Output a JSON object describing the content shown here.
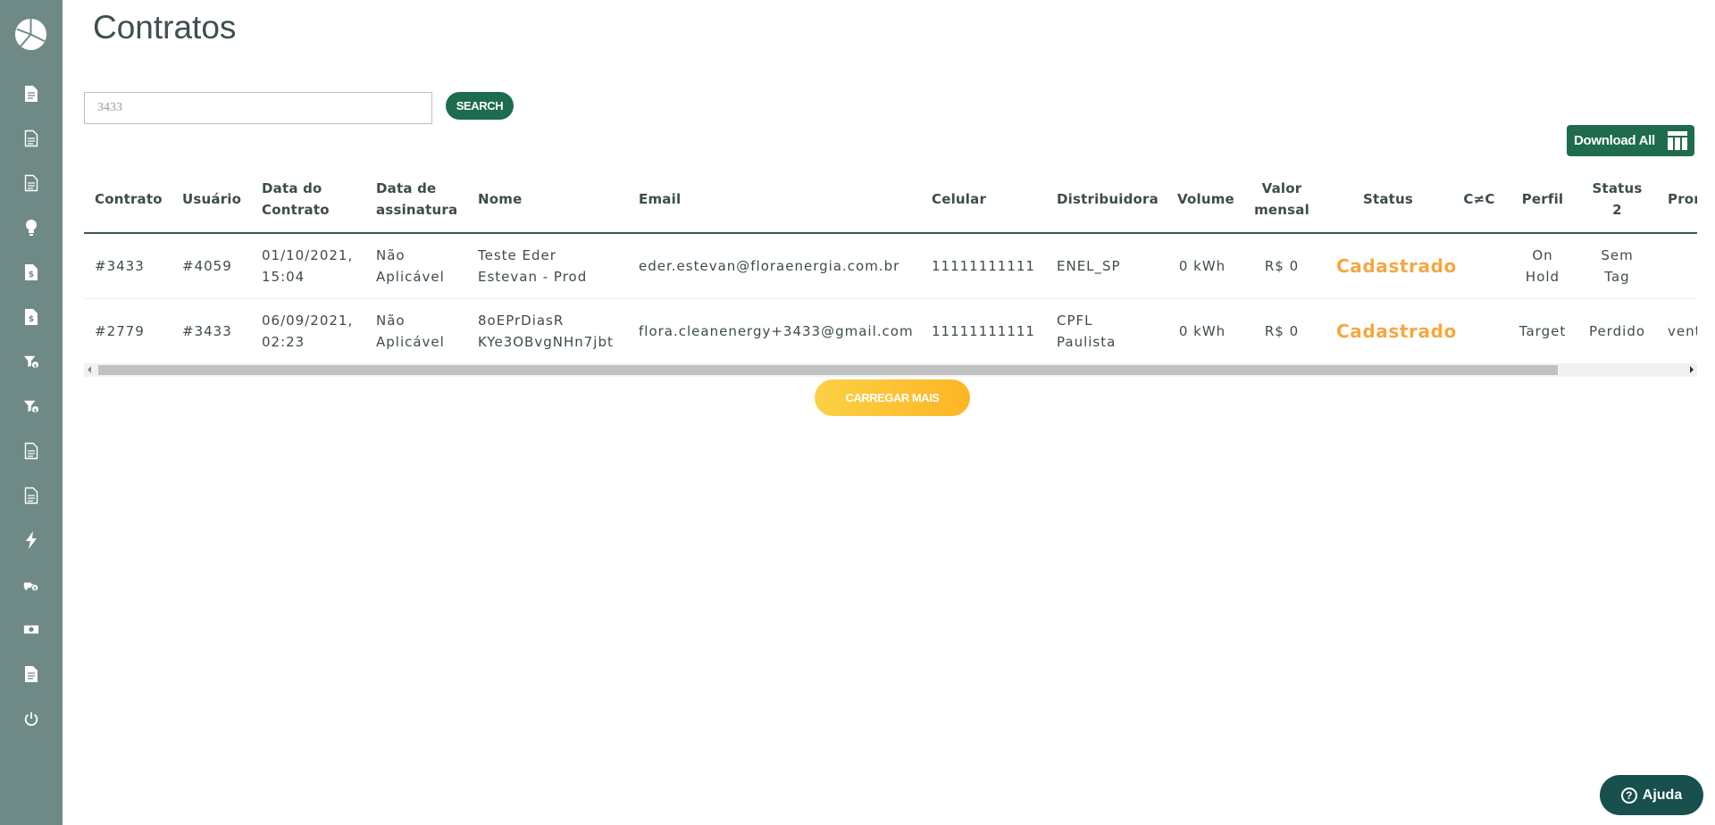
{
  "page": {
    "title": "Contratos"
  },
  "search": {
    "value": "3433",
    "button_label": "SEARCH"
  },
  "download": {
    "label": "Download All",
    "icon": "table-icon"
  },
  "sidebar": {
    "logo": "flora-logo",
    "items": [
      {
        "icon": "document-filled-icon"
      },
      {
        "icon": "document-icon"
      },
      {
        "icon": "document-icon"
      },
      {
        "icon": "lightbulb-icon"
      },
      {
        "icon": "money-document-icon"
      },
      {
        "icon": "money-document-icon"
      },
      {
        "icon": "filter-money-icon"
      },
      {
        "icon": "filter-money-icon"
      },
      {
        "icon": "document-icon"
      },
      {
        "icon": "document-icon"
      },
      {
        "icon": "lightning-icon"
      },
      {
        "icon": "truck-money-icon"
      },
      {
        "icon": "banknote-icon"
      },
      {
        "icon": "document-filled-icon"
      },
      {
        "icon": "power-icon"
      }
    ]
  },
  "table": {
    "headers": {
      "contrato": "Contrato",
      "usuario": "Usuário",
      "data_contrato_1": "Data do",
      "data_contrato_2": "Contrato",
      "data_assinatura_1": "Data de",
      "data_assinatura_2": "assinatura",
      "nome": "Nome",
      "email": "Email",
      "celular": "Celular",
      "distribuidora": "Distribuidora",
      "volume": "Volume",
      "valor_1": "Valor",
      "valor_2": "mensal",
      "status": "Status",
      "cc": "C≠C",
      "perfil": "Perfil",
      "status2_1": "Status",
      "status2_2": "2",
      "promo": "Promo"
    },
    "rows": [
      {
        "contrato": "#3433",
        "usuario": "#4059",
        "data_contrato_1": "01/10/2021,",
        "data_contrato_2": "15:04",
        "data_assinatura_1": "Não",
        "data_assinatura_2": "Aplicável",
        "nome_1": "Teste Eder",
        "nome_2": "Estevan - Prod",
        "email": "eder.estevan@floraenergia.com.br",
        "celular": "11111111111",
        "distribuidora_1": "ENEL_SP",
        "distribuidora_2": "",
        "volume": "0 kWh",
        "valor": "R$ 0",
        "status": "Cadastrado",
        "cc": "",
        "perfil_1": "On",
        "perfil_2": "Hold",
        "status2_1": "Sem",
        "status2_2": "Tag",
        "promo": ""
      },
      {
        "contrato": "#2779",
        "usuario": "#3433",
        "data_contrato_1": "06/09/2021,",
        "data_contrato_2": "02:23",
        "data_assinatura_1": "Não",
        "data_assinatura_2": "Aplicável",
        "nome_1": "8oEPrDiasR",
        "nome_2": "KYe3OBvgNHn7jbt",
        "email": "flora.cleanenergy+3433@gmail.com",
        "celular": "11111111111",
        "distribuidora_1": "CPFL",
        "distribuidora_2": "Paulista",
        "volume": "0 kWh",
        "valor": "R$ 0",
        "status": "Cadastrado",
        "cc": "",
        "perfil_1": "Target",
        "perfil_2": "",
        "status2_1": "Perdido",
        "status2_2": "",
        "promo": "vent"
      }
    ]
  },
  "load_more": {
    "label": "CARREGAR MAIS"
  },
  "help": {
    "label": "Ajuda"
  },
  "colors": {
    "sidebar": "#6f8a86",
    "primary_green": "#1e6b4d",
    "status_orange": "#f5a742",
    "load_more_yellow": "#fdb524",
    "help_bg": "#17504d"
  }
}
